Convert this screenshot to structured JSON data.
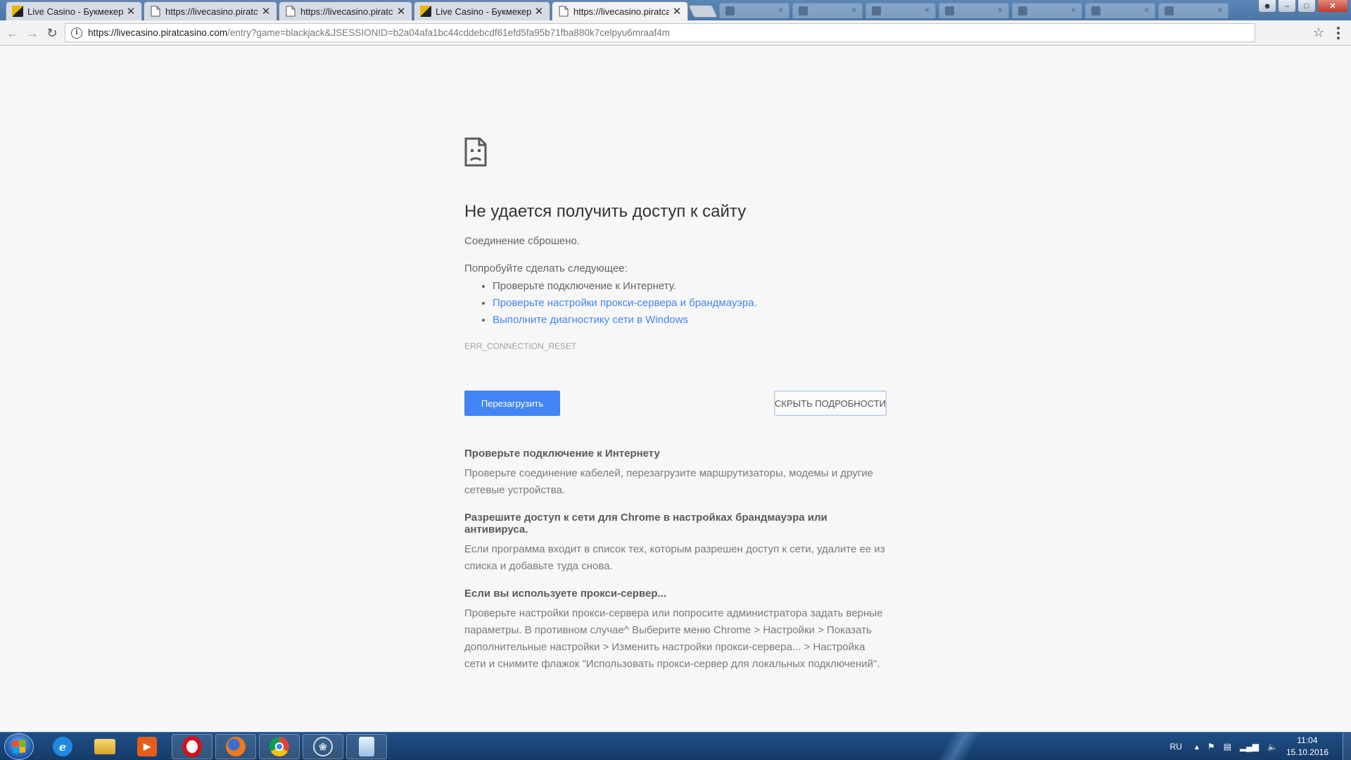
{
  "browser": {
    "tabs": [
      {
        "title": "Live Casino - Букмекерс",
        "favicon": "casino-favicon",
        "active": false
      },
      {
        "title": "https://livecasino.piratca",
        "favicon": "doc-favicon",
        "active": false
      },
      {
        "title": "https://livecasino.piratca",
        "favicon": "doc-favicon",
        "active": false
      },
      {
        "title": "Live Casino - Букмекерс",
        "favicon": "casino-favicon",
        "active": false
      },
      {
        "title": "https://livecasino.piratca",
        "favicon": "doc-favicon",
        "active": true
      }
    ],
    "close_glyph": "✕",
    "address": {
      "host": "https://livecasino.piratcasino.com",
      "path": "/entry?game=blackjack&JSESSIONID=b2a04afa1bc44cddebcdf61efd5fa95b71fba880k7celpyu6mraaf4m"
    }
  },
  "error_page": {
    "heading": "Не удается получить доступ к сайту",
    "reason": "Соединение сброшено.",
    "try_label": "Попробуйте сделать следующее:",
    "suggestions": [
      {
        "text": "Проверьте подключение к Интернету.",
        "link": false
      },
      {
        "text": "Проверьте настройки прокси-сервера и брандмауэра.",
        "link": true
      },
      {
        "text": "Выполните диагностику сети в Windows",
        "link": true
      }
    ],
    "error_code": "ERR_CONNECTION_RESET",
    "reload_label": "Перезагрузить",
    "details_label": "СКРЫТЬ ПОДРОБНОСТИ",
    "details": [
      {
        "title": "Проверьте подключение к Интернету",
        "body": "Проверьте соединение кабелей, перезагрузите маршрутизаторы, модемы и другие сетевые устройства."
      },
      {
        "title": "Разрешите доступ к сети для Chrome в настройках брандмауэра или антивируса.",
        "body": "Если программа входит в список тех, которым разрешен доступ к сети, удалите ее из списка и добавьте туда снова."
      },
      {
        "title": "Если вы используете прокси-сервер...",
        "body": "Проверьте настройки прокси-сервера или попросите администратора задать верные параметры. В противном случае^ Выберите меню Chrome > Настройки > Показать дополнительные настройки > Изменить настройки прокси-сервера... > Настройка сети и снимите флажок \"Использовать прокси-сервер для локальных подключений\"."
      }
    ]
  },
  "taskbar": {
    "apps": [
      "internet-explorer-icon",
      "explorer-folder-icon",
      "media-player-icon",
      "opera-icon",
      "firefox-icon",
      "chrome-icon",
      "network-app-icon",
      "notepad-icon"
    ],
    "lang": "RU",
    "time": "11:04",
    "date": "15.10.2016"
  }
}
